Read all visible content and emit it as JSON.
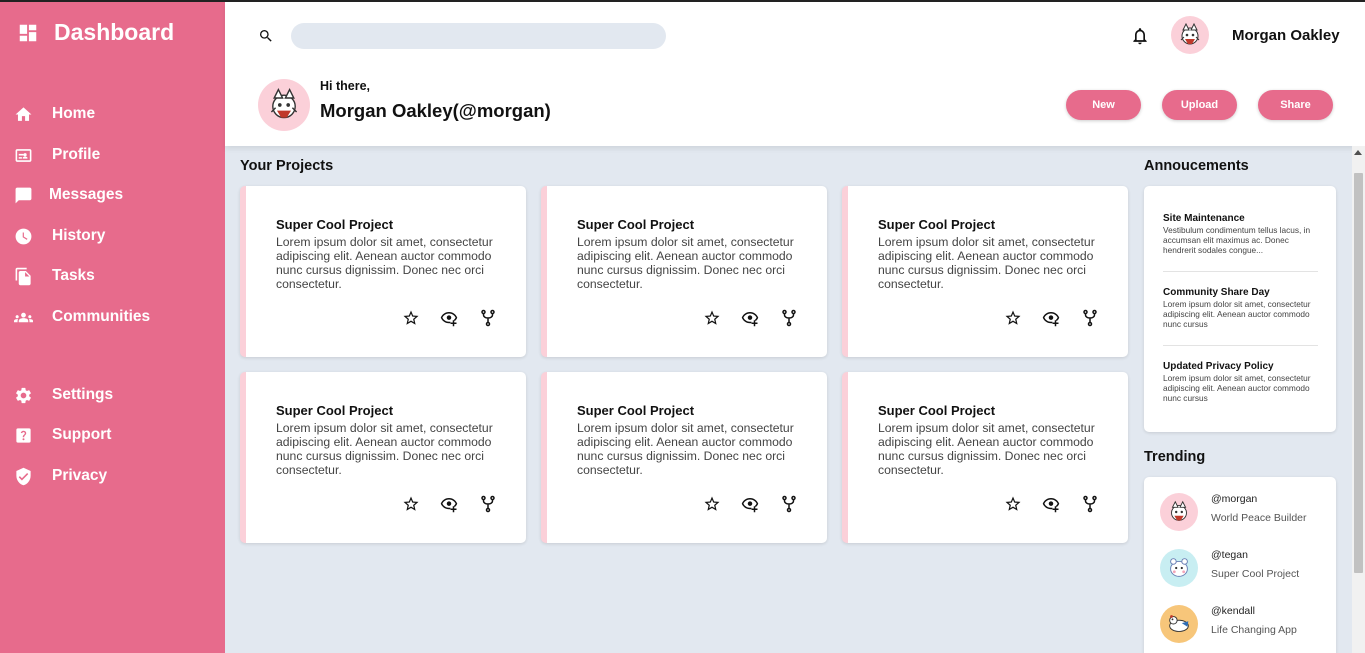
{
  "app": {
    "title": "Dashboard"
  },
  "sidebar": {
    "items": [
      {
        "label": "Home",
        "icon": "home-icon"
      },
      {
        "label": "Profile",
        "icon": "id-card-icon"
      },
      {
        "label": "Messages",
        "icon": "chat-icon"
      },
      {
        "label": "History",
        "icon": "clock-icon"
      },
      {
        "label": "Tasks",
        "icon": "documents-icon"
      },
      {
        "label": "Communities",
        "icon": "people-icon"
      },
      {
        "label": "Settings",
        "icon": "gear-icon"
      },
      {
        "label": "Support",
        "icon": "help-icon"
      },
      {
        "label": "Privacy",
        "icon": "shield-icon"
      }
    ]
  },
  "header": {
    "search": {
      "placeholder": "",
      "value": ""
    },
    "user_name": "Morgan Oakley",
    "greeting": "Hi there,",
    "full_handle": "Morgan Oakley(@morgan)",
    "buttons": {
      "new": "New",
      "upload": "Upload",
      "share": "Share"
    }
  },
  "projects": {
    "title": "Your Projects",
    "items": [
      {
        "title": "Super Cool Project",
        "desc": "Lorem ipsum dolor sit amet, consectetur adipiscing elit. Aenean auctor commodo nunc cursus dignissim. Donec nec orci consectetur."
      },
      {
        "title": "Super Cool Project",
        "desc": "Lorem ipsum dolor sit amet, consectetur adipiscing elit. Aenean auctor commodo nunc cursus dignissim. Donec nec orci consectetur."
      },
      {
        "title": "Super Cool Project",
        "desc": "Lorem ipsum dolor sit amet, consectetur adipiscing elit. Aenean auctor commodo nunc cursus dignissim. Donec nec orci consectetur."
      },
      {
        "title": "Super Cool Project",
        "desc": "Lorem ipsum dolor sit amet, consectetur adipiscing elit. Aenean auctor commodo nunc cursus dignissim. Donec nec orci consectetur."
      },
      {
        "title": "Super Cool Project",
        "desc": "Lorem ipsum dolor sit amet, consectetur adipiscing elit. Aenean auctor commodo nunc cursus dignissim. Donec nec orci consectetur."
      },
      {
        "title": "Super Cool Project",
        "desc": "Lorem ipsum dolor sit amet, consectetur adipiscing elit. Aenean auctor commodo nunc cursus dignissim. Donec nec orci consectetur."
      }
    ],
    "actions": [
      "star-icon",
      "watch-icon",
      "fork-icon"
    ]
  },
  "announcements": {
    "title": "Annoucements",
    "items": [
      {
        "title": "Site Maintenance",
        "body": "Vestibulum condimentum tellus lacus, in accumsan elit maximus ac. Donec hendrerit sodales congue..."
      },
      {
        "title": "Community Share Day",
        "body": "Lorem ipsum dolor sit amet, consectetur adipiscing elit. Aenean auctor commodo nunc cursus"
      },
      {
        "title": "Updated Privacy Policy",
        "body": "Lorem ipsum dolor sit amet, consectetur adipiscing elit. Aenean auctor commodo nunc cursus"
      }
    ]
  },
  "trending": {
    "title": "Trending",
    "items": [
      {
        "handle": "@morgan",
        "project": "World Peace Builder"
      },
      {
        "handle": "@tegan",
        "project": "Super Cool Project"
      },
      {
        "handle": "@kendall",
        "project": "Life Changing App"
      }
    ]
  },
  "colors": {
    "accent": "#e76b8c",
    "accent_light": "#fbd0d9",
    "background": "#e2e8f0"
  }
}
